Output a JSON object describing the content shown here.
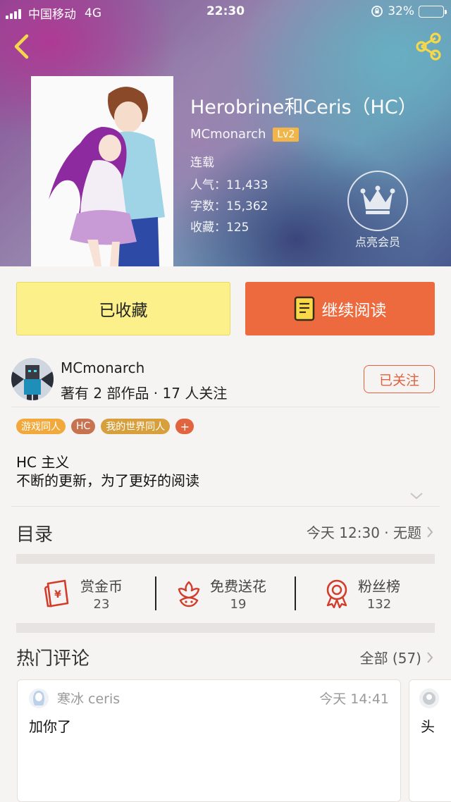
{
  "status_bar": {
    "carrier": "中国移动",
    "network": "4G",
    "time": "22:30",
    "battery_text": "32%",
    "battery_level": 0.32
  },
  "book": {
    "title": "Herobrine和Ceris（HC）",
    "author": "MCmonarch",
    "level_badge": "Lv2",
    "status": "连载",
    "popularity": "人气：11,433",
    "word_count": "字数：15,362",
    "favorites": "收藏：125"
  },
  "vip": {
    "label": "点亮会员"
  },
  "actions": {
    "collect_label": "已收藏",
    "read_label": "继续阅读"
  },
  "author": {
    "name": "MCmonarch",
    "stats": "著有 2 部作品 · 17 人关注",
    "follow_label": "已关注"
  },
  "tags": [
    {
      "label": "游戏同人",
      "color": "#f2a93b"
    },
    {
      "label": "HC",
      "color": "#c8734f"
    },
    {
      "label": "我的世界同人",
      "color": "#d7a03c"
    }
  ],
  "tag_add": "+",
  "description": {
    "line1": "HC 主义",
    "line2": "不断的更新，为了更好的阅读"
  },
  "toc": {
    "title": "目录",
    "latest": "今天 12:30 · 无题"
  },
  "stats": [
    {
      "label": "赏金币",
      "value": "23",
      "icon": "money-envelope-icon"
    },
    {
      "label": "免费送花",
      "value": "19",
      "icon": "flower-icon"
    },
    {
      "label": "粉丝榜",
      "value": "132",
      "icon": "medal-icon"
    }
  ],
  "comments": {
    "title": "热门评论",
    "all_label": "全部 (57)",
    "items": [
      {
        "user": "寒冰 ceris",
        "time": "今天 14:41",
        "text": "加你了"
      },
      {
        "text": "头"
      }
    ]
  },
  "colors": {
    "accent_orange": "#ec6a3d",
    "collect_yellow": "#fbf08a",
    "follow_red": "#e0603f"
  }
}
